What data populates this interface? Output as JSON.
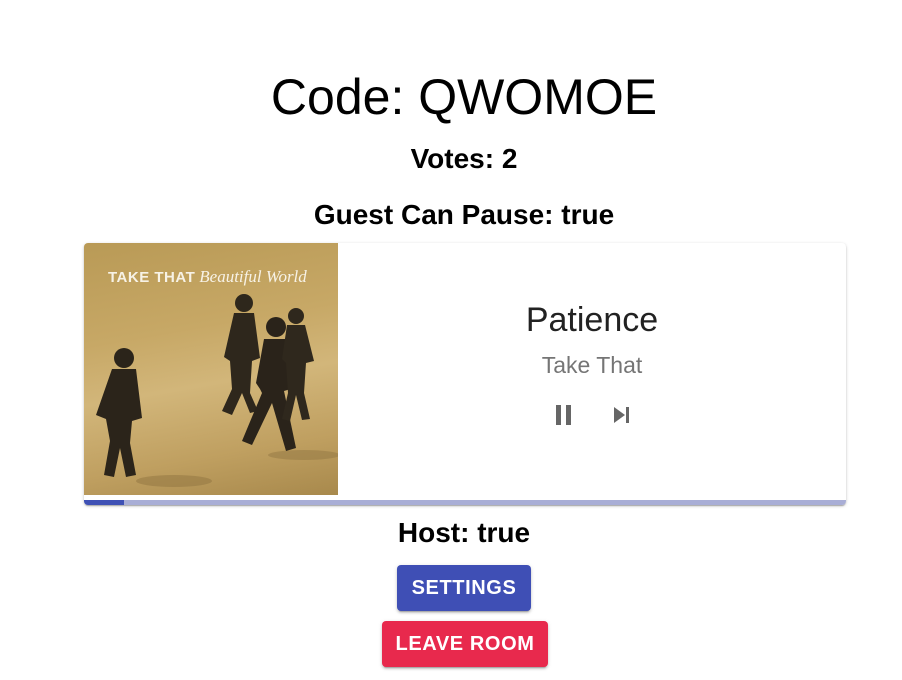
{
  "room": {
    "code_text": "Code: QWOMOE",
    "votes_text": "Votes: 2",
    "guest_can_pause_text": "Guest Can Pause: true",
    "host_text": "Host: true"
  },
  "player": {
    "album_band": "TAKE THAT",
    "album_title": "Beautiful World",
    "song_title": "Patience",
    "artist": "Take That",
    "progress_fraction": 0.053,
    "pause_icon": "pause-icon",
    "skip_icon": "skip-next-icon"
  },
  "buttons": {
    "settings_label": "SETTINGS",
    "leave_label": "LEAVE ROOM"
  },
  "colors": {
    "primary": "#3f51b5",
    "secondary": "#e8294d",
    "progress_track": "#a9aed6"
  }
}
